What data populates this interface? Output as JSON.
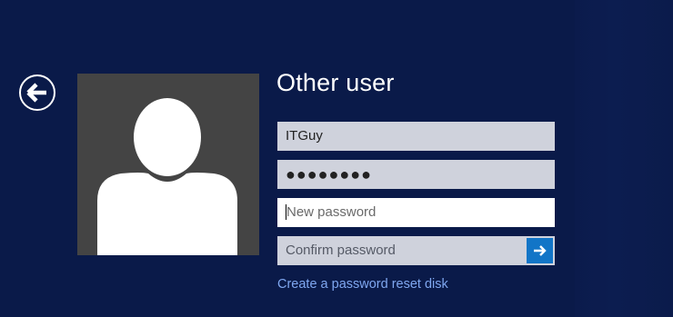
{
  "login": {
    "title": "Other user",
    "username_value": "ITGuy",
    "old_password_value": "●●●●●●●●",
    "new_password_placeholder": "New password",
    "confirm_password_placeholder": "Confirm password",
    "reset_link_label": "Create a password reset disk"
  },
  "icons": {
    "back": "back-arrow-icon",
    "submit": "right-arrow-icon",
    "avatar": "user-silhouette-icon"
  },
  "colors": {
    "background": "#0a1a49",
    "avatar_bg": "#444444",
    "field_bg": "#cfd2dc",
    "field_focused_bg": "#ffffff",
    "submit_bg": "#1275c7",
    "link": "#7fa7f0"
  }
}
